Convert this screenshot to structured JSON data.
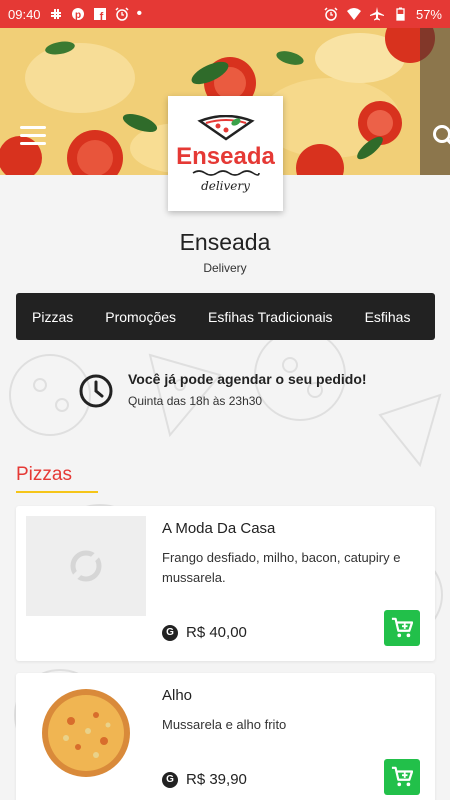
{
  "status_bar": {
    "time": "09:40",
    "battery": "57%",
    "left_icons": [
      "slack-icon",
      "pinterest-icon",
      "facebook-icon",
      "alarm-icon",
      "dot-icon"
    ],
    "right_icons": [
      "alarm-icon",
      "wifi-icon",
      "airplane-icon",
      "battery-icon"
    ]
  },
  "header": {
    "menu_icon": "hamburger-icon",
    "search_icon": "search-icon"
  },
  "logo": {
    "name": "Enseada",
    "tagline": "delivery"
  },
  "store": {
    "name": "Enseada",
    "subtitle": "Delivery"
  },
  "tabs": [
    "Pizzas",
    "Promoções",
    "Esfihas Tradicionais",
    "Esfihas"
  ],
  "notice": {
    "title": "Você já pode agendar o seu pedido!",
    "hours": "Quinta das 18h às 23h30"
  },
  "section": {
    "title": "Pizzas"
  },
  "products": [
    {
      "name": "A Moda Da Casa",
      "description": "Frango desfiado, milho, bacon, catupiry e mussarela.",
      "price": "R$ 40,00",
      "coin": "G",
      "image": "placeholder"
    },
    {
      "name": "Alho",
      "description": "Mussarela e alho frito",
      "price": "R$ 39,90",
      "coin": "G",
      "image": "pizza"
    }
  ],
  "colors": {
    "status_bar": "#e53935",
    "accent_red": "#e53935",
    "tabs_bg": "#222222",
    "cart_green": "#22c04a",
    "underline_yellow": "#f5c518"
  }
}
